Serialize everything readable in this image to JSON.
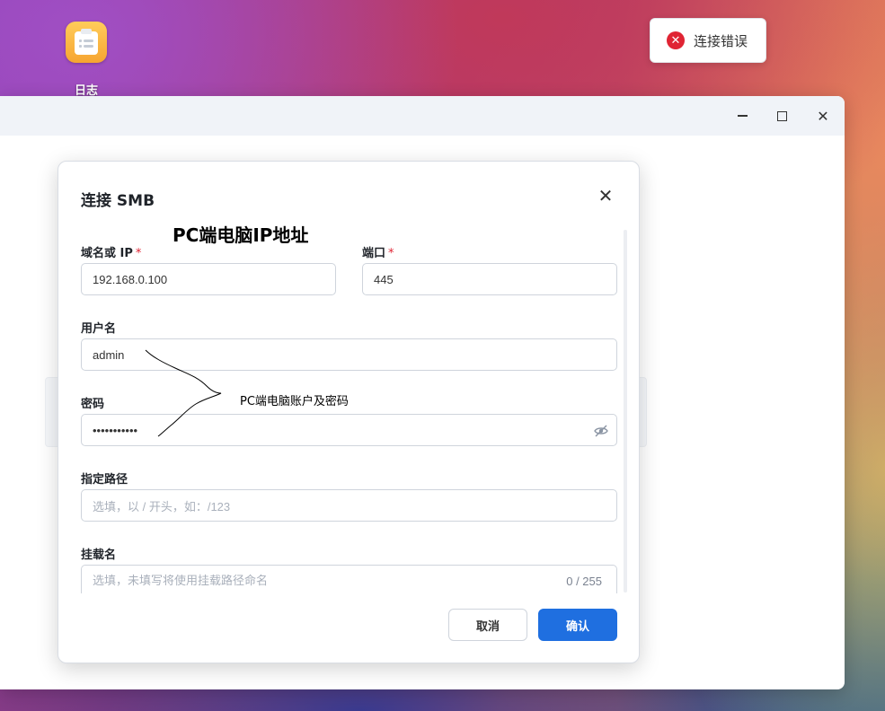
{
  "desktop": {
    "icons": [
      {
        "label": "日志",
        "icon": "clipboard-list-icon"
      }
    ]
  },
  "toast": {
    "type": "error",
    "icon": "error-circle-icon",
    "message": "连接错误",
    "color": "#e02433"
  },
  "window": {
    "controls": {
      "minimize": "minimize-icon",
      "maximize": "maximize-icon",
      "close": "close-icon"
    }
  },
  "dialog": {
    "title": "连接 SMB",
    "close_icon": "close-icon",
    "annotation_title": "PC端电脑IP地址",
    "annotation_text": "PC端电脑账户及密码",
    "fields": {
      "host": {
        "label": "域名或 IP",
        "required": "*",
        "value": "192.168.0.100"
      },
      "port": {
        "label": "端口",
        "required": "*",
        "value": "445"
      },
      "username": {
        "label": "用户名",
        "value": "admin"
      },
      "password": {
        "label": "密码",
        "value": "•••••••••••",
        "toggle_icon": "eye-off-icon"
      },
      "path": {
        "label": "指定路径",
        "placeholder": "选填，以 / 开头，如：/123"
      },
      "mount_name": {
        "label": "挂载名",
        "placeholder": "选填，未填写将使用挂载路径命名",
        "counter": "0 / 255"
      }
    },
    "buttons": {
      "cancel": "取消",
      "confirm": "确认"
    },
    "accent_color": "#1f6fe0"
  }
}
